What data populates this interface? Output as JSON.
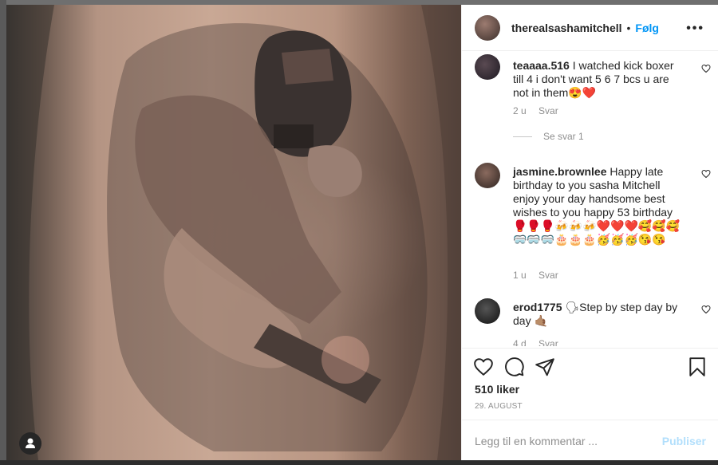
{
  "header": {
    "username": "therealsashamitchell",
    "separator": "•",
    "follow_label": "Følg",
    "more_label": "•••"
  },
  "comments": [
    {
      "user": "teaaaa.516",
      "text": "I watched kick boxer till 4 i don't want 5 6 7 bcs u are not in them😍❤️",
      "time": "2 u",
      "reply_label": "Svar",
      "view_replies": "Se svar 1"
    },
    {
      "user": "jasmine.brownlee",
      "text": "Happy late birthday to you sasha Mitchell enjoy your day handsome best wishes to you happy 53 birthday 🥊🥊🥊🍻🍻🍻❤️❤️❤️🥰🥰🥰🥽🥽🥽🎂🎂🎂🥳🥳🥳😘😘",
      "time": "1 u",
      "reply_label": "Svar"
    },
    {
      "user": "erod1775",
      "text": "🗣Step by step day by day 🤙🏽",
      "time": "4 d",
      "reply_label": "Svar"
    }
  ],
  "actions": {
    "like_icon": "heart-icon",
    "comment_icon": "comment-icon",
    "share_icon": "paper-plane-icon",
    "save_icon": "bookmark-icon"
  },
  "likes": "510 liker",
  "date": "29. AUGUST",
  "add_comment": {
    "placeholder": "Legg til en kommentar ...",
    "post_label": "Publiser"
  },
  "colors": {
    "accent": "#0095f6",
    "text": "#262626",
    "muted": "#8e8e8e",
    "post_disabled": "#b2dffc"
  }
}
